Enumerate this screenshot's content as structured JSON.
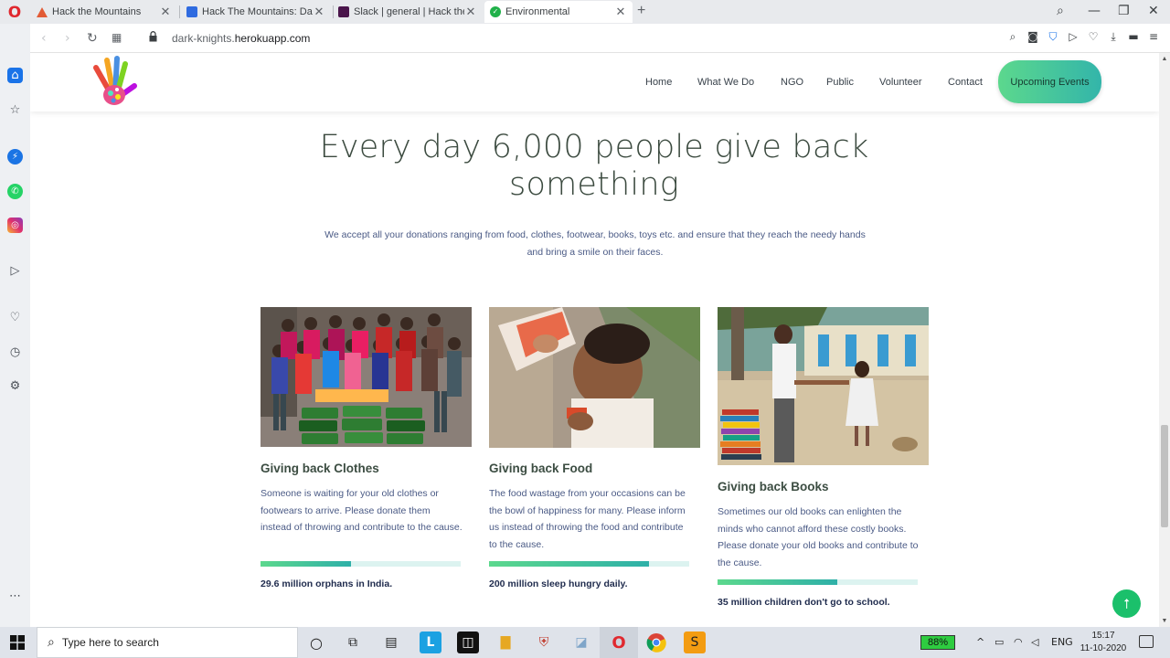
{
  "browser": {
    "tabs": [
      {
        "title": "Hack the Mountains",
        "fav_color": "#e25b35"
      },
      {
        "title": "Hack The Mountains: Dash",
        "fav_color": "#2f6be0"
      },
      {
        "title": "Slack | general | Hack the M",
        "fav_color": "#4a154b"
      },
      {
        "title": "Environmental",
        "fav_color": "#21b14a"
      }
    ],
    "url_prefix": "dark-knights.",
    "url_domain": "herokuapp.com"
  },
  "site": {
    "nav": [
      "Home",
      "What We Do",
      "NGO",
      "Public",
      "Volunteer",
      "Contact"
    ],
    "cta": "Upcoming Events",
    "heading": "Every day 6,000 people give back something",
    "intro": "We accept all your donations ranging from food, clothes, footwear, books, toys etc. and ensure that they reach the needy hands and bring a smile on their faces.",
    "cards": [
      {
        "title": "Giving back Clothes",
        "text": "Someone is waiting for your old clothes or footwears to arrive. Please donate them instead of throwing and contribute to the cause.",
        "progress": 0.45,
        "stat": "29.6 million orphans in India."
      },
      {
        "title": "Giving back Food",
        "text": "The food wastage from your occasions can be the bowl of happiness for many. Please inform us instead of throwing the food and contribute to the cause.",
        "progress": 0.8,
        "stat": "200 million sleep hungry daily."
      },
      {
        "title": "Giving back Books",
        "text": "Sometimes our old books can enlighten the minds who cannot afford these costly books. Please donate your old books and contribute to the cause.",
        "progress": 0.6,
        "stat": "35 million children don't go to school."
      }
    ]
  },
  "taskbar": {
    "search_placeholder": "Type here to search",
    "battery": "88%",
    "lang": "ENG",
    "time": "15:17",
    "date": "11-10-2020"
  },
  "colors": {
    "accent_green": "#5cd88d",
    "accent_teal": "#2eb0a8",
    "heading": "#3b4a3f",
    "body_text": "#4a5a85"
  }
}
